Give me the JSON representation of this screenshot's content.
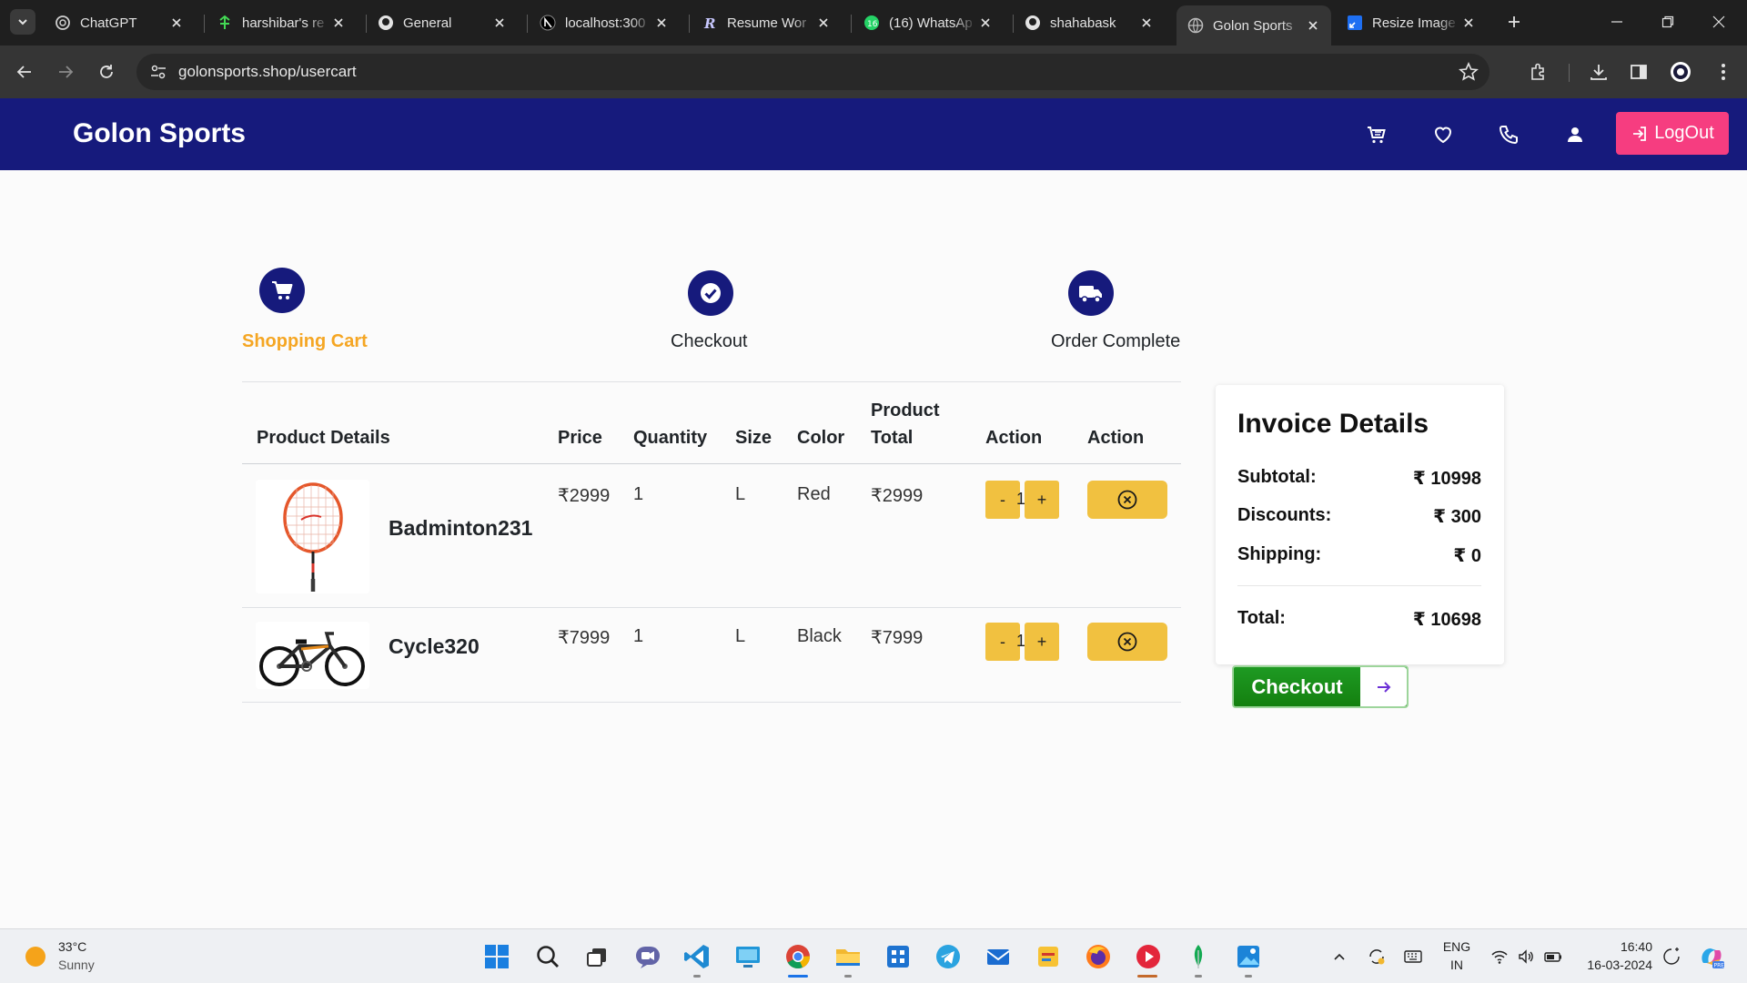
{
  "browser": {
    "tabs": [
      {
        "title": "ChatGPT",
        "icon": "chatgpt-icon"
      },
      {
        "title": "harshibar's re",
        "icon": "linktree-icon"
      },
      {
        "title": "General",
        "icon": "github-icon"
      },
      {
        "title": "localhost:300",
        "icon": "nextjs-icon"
      },
      {
        "title": "Resume Wor",
        "icon": "resume-worded-icon"
      },
      {
        "title": "(16) WhatsAp",
        "icon": "whatsapp-icon"
      },
      {
        "title": "shahabask",
        "icon": "github-icon"
      },
      {
        "title": "Golon Sports",
        "icon": "globe-icon",
        "active": true
      },
      {
        "title": "Resize Image",
        "icon": "resize-image-icon"
      }
    ],
    "url": "golonsports.shop/usercart"
  },
  "site": {
    "brand": "Golon Sports",
    "nav_icons": [
      "cart-icon",
      "heart-icon",
      "phone-icon",
      "user-icon"
    ],
    "logout_label": "LogOut",
    "brand_color": "#161a7c",
    "logout_color": "#f63d80"
  },
  "steps": [
    {
      "label": "Shopping Cart",
      "icon": "shopping-cart-icon",
      "active": true
    },
    {
      "label": "Checkout",
      "icon": "check-circle-icon",
      "active": false
    },
    {
      "label": "Order Complete",
      "icon": "truck-icon",
      "active": false
    }
  ],
  "cart": {
    "headers": {
      "product": "Product Details",
      "price": "Price",
      "quantity": "Quantity",
      "size": "Size",
      "color": "Color",
      "total_line1": "Product",
      "total_line2": "Total",
      "action1": "Action",
      "action2": "Action"
    },
    "rows": [
      {
        "name": "Badminton231",
        "price": "₹2999",
        "quantity": "1",
        "size": "L",
        "color": "Red",
        "total": "₹2999",
        "qty_value": "1",
        "minus": "-",
        "plus": "+",
        "image": "badminton-racket-image"
      },
      {
        "name": "Cycle320",
        "price": "₹7999",
        "quantity": "1",
        "size": "L",
        "color": "Black",
        "total": "₹7999",
        "qty_value": "1",
        "minus": "-",
        "plus": "+",
        "image": "bicycle-image"
      }
    ]
  },
  "invoice": {
    "title": "Invoice Details",
    "subtotal_label": "Subtotal:",
    "subtotal_value": "₹ 10998",
    "discounts_label": "Discounts:",
    "discounts_value": "₹ 300",
    "shipping_label": "Shipping:",
    "shipping_value": "₹ 0",
    "total_label": "Total:",
    "total_value": "₹ 10698",
    "checkout_label": "Checkout"
  },
  "taskbar": {
    "temperature": "33°C",
    "condition": "Sunny",
    "lang_line1": "ENG",
    "lang_line2": "IN",
    "time": "16:40",
    "date": "16-03-2024"
  }
}
